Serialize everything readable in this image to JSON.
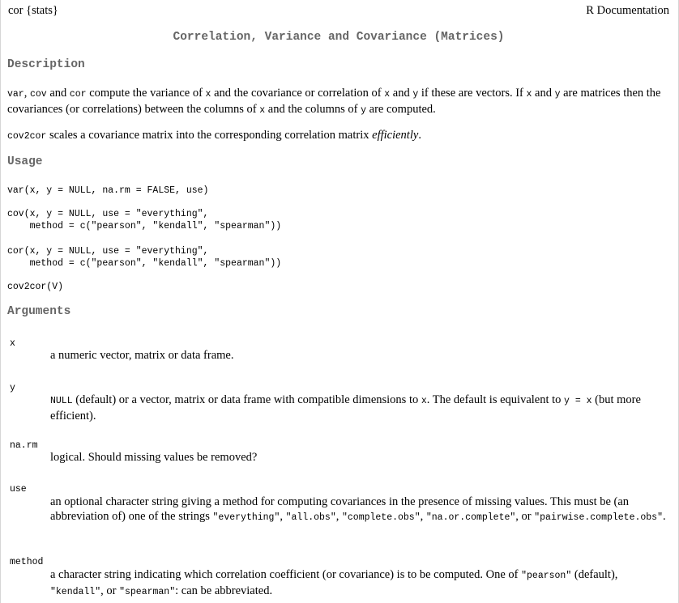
{
  "header": {
    "topic": "cor {stats}",
    "source": "R Documentation"
  },
  "title": "Correlation, Variance and Covariance (Matrices)",
  "description": {
    "heading": "Description",
    "p1": {
      "c1": "var",
      "t1": ", ",
      "c2": "cov",
      "t2": " and ",
      "c3": "cor",
      "t3": " compute the variance of ",
      "c4": "x",
      "t4": " and the covariance or correlation of ",
      "c5": "x",
      "t5": " and ",
      "c6": "y",
      "t6": " if these are vectors. If ",
      "c7": "x",
      "t7": " and ",
      "c8": "y",
      "t8": " are matrices then the covariances (or correlations) between the columns of ",
      "c9": "x",
      "t9": " and the columns of ",
      "c10": "y",
      "t10": " are computed."
    },
    "p2": {
      "c1": "cov2cor",
      "t1": " scales a covariance matrix into the corresponding correlation matrix ",
      "em": "efficiently",
      "t2": "."
    }
  },
  "usage": {
    "heading": "Usage",
    "code1": "var(x, y = NULL, na.rm = FALSE, use)",
    "code2": "cov(x, y = NULL, use = \"everything\",\n    method = c(\"pearson\", \"kendall\", \"spearman\"))",
    "code3": "cor(x, y = NULL, use = \"everything\",\n    method = c(\"pearson\", \"kendall\", \"spearman\"))",
    "code4": "cov2cor(V)"
  },
  "arguments": {
    "heading": "Arguments",
    "x": {
      "name": "x",
      "desc": "a numeric vector, matrix or data frame."
    },
    "y": {
      "name": "y",
      "c1": "NULL",
      "t1": " (default) or a vector, matrix or data frame with compatible dimensions to ",
      "c2": "x",
      "t2": ". The default is equivalent to ",
      "c3": "y = x",
      "t3": " (but more efficient)."
    },
    "narm": {
      "name": "na.rm",
      "desc": "logical. Should missing values be removed?"
    },
    "use": {
      "name": "use",
      "t1": "an optional character string giving a method for computing covariances in the presence of missing values. This must be (an abbreviation of) one of the strings ",
      "c1": "\"everything\"",
      "s1": ", ",
      "c2": "\"all.obs\"",
      "s2": ", ",
      "c3": "\"complete.obs\"",
      "s3": ", ",
      "c4": "\"na.or.complete\"",
      "s4": ", or ",
      "c5": "\"pairwise.complete.obs\"",
      "s5": "."
    },
    "method": {
      "name": "method",
      "t1": "a character string indicating which correlation coefficient (or covariance) is to be computed. One of ",
      "c1": "\"pearson\"",
      "s1": " (default), ",
      "c2": "\"kendall\"",
      "s2": ", or ",
      "c3": "\"spearman\"",
      "s3": ": can be abbreviated."
    }
  }
}
